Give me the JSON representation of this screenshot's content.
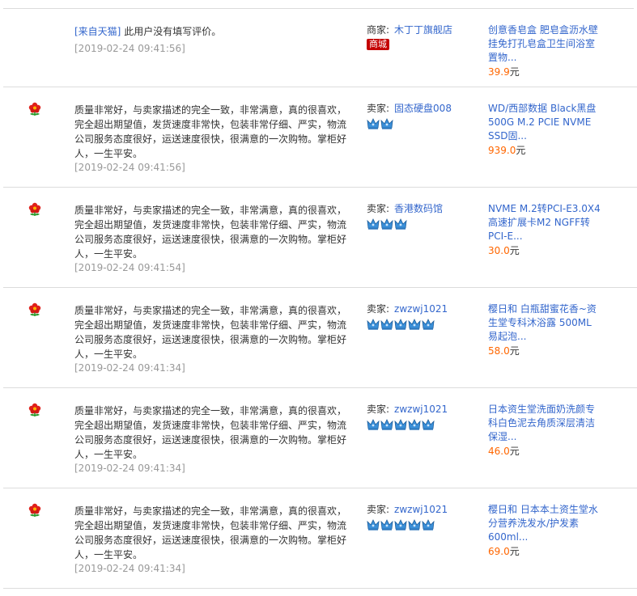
{
  "reviews": [
    {
      "source_tag": "[来自天猫]",
      "comment": "此用户没有填写评价。",
      "date": "[2019-02-24 09:41:56]",
      "seller_label": "商家:",
      "seller_name": "木丁丁旗舰店",
      "badge": "商城",
      "crowns": 0,
      "item_title": "创意香皂盒 肥皂盒沥水壁挂免打孔皂盒卫生间浴室置物...",
      "price": "39.9",
      "unit": "元",
      "has_flower": false
    },
    {
      "comment": "质量非常好，与卖家描述的完全一致，非常满意，真的很喜欢，完全超出期望值，发货速度非常快，包装非常仔细、严实，物流公司服务态度很好，运送速度很快，很满意的一次购物。掌柜好人，一生平安。",
      "date": "[2019-02-24 09:41:56]",
      "seller_label": "卖家:",
      "seller_name": "固态硬盘008",
      "crowns": 2,
      "item_title": "WD/西部数据 Black黑盘 500G M.2 PCIE NVME SSD固...",
      "price": "939.0",
      "unit": "元",
      "has_flower": true
    },
    {
      "comment": "质量非常好，与卖家描述的完全一致，非常满意，真的很喜欢，完全超出期望值，发货速度非常快，包装非常仔细、严实，物流公司服务态度很好，运送速度很快，很满意的一次购物。掌柜好人，一生平安。",
      "date": "[2019-02-24 09:41:54]",
      "seller_label": "卖家:",
      "seller_name": "香港数码馆",
      "crowns": 3,
      "item_title": "NVME M.2转PCI-E3.0X4 高速扩展卡M2 NGFF转PCI-E...",
      "price": "30.0",
      "unit": "元",
      "has_flower": true
    },
    {
      "comment": "质量非常好，与卖家描述的完全一致，非常满意，真的很喜欢，完全超出期望值，发货速度非常快，包装非常仔细、严实，物流公司服务态度很好，运送速度很快，很满意的一次购物。掌柜好人，一生平安。",
      "date": "[2019-02-24 09:41:34]",
      "seller_label": "卖家:",
      "seller_name": "zwzwj1021",
      "crowns": 5,
      "item_title": "樱日和 白瓶甜蜜花香~资生堂专科沐浴露 500ML 易起泡...",
      "price": "58.0",
      "unit": "元",
      "has_flower": true
    },
    {
      "comment": "质量非常好，与卖家描述的完全一致，非常满意，真的很喜欢，完全超出期望值，发货速度非常快，包装非常仔细、严实，物流公司服务态度很好，运送速度很快，很满意的一次购物。掌柜好人，一生平安。",
      "date": "[2019-02-24 09:41:34]",
      "seller_label": "卖家:",
      "seller_name": "zwzwj1021",
      "crowns": 5,
      "item_title": "日本资生堂洗面奶洗颜专科白色泥去角质深层清洁保湿...",
      "price": "46.0",
      "unit": "元",
      "has_flower": true
    },
    {
      "comment": "质量非常好，与卖家描述的完全一致，非常满意，真的很喜欢，完全超出期望值，发货速度非常快，包装非常仔细、严实，物流公司服务态度很好，运送速度很快，很满意的一次购物。掌柜好人，一生平安。",
      "date": "[2019-02-24 09:41:34]",
      "seller_label": "卖家:",
      "seller_name": "zwzwj1021",
      "crowns": 5,
      "item_title": "樱日和 日本本土资生堂水分营养洗发水/护发素 600ml...",
      "price": "69.0",
      "unit": "元",
      "has_flower": true
    }
  ]
}
